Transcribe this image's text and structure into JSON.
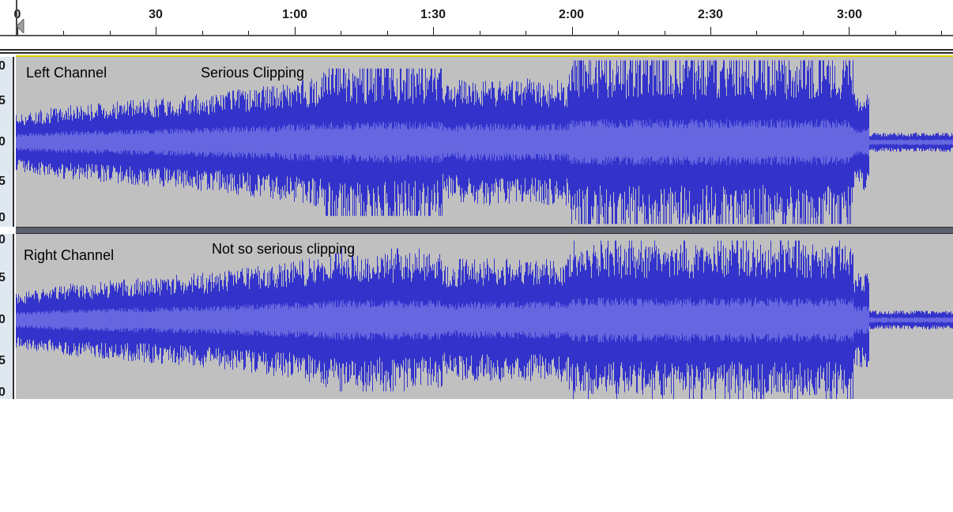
{
  "timeline": {
    "labels": [
      "0",
      "30",
      "1:00",
      "1:30",
      "2:00",
      "2:30",
      "3:00"
    ]
  },
  "vertical_scale": {
    "labels": [
      "0",
      "5",
      "0",
      "5",
      "0"
    ]
  },
  "tracks": {
    "left": {
      "name": "Left Channel",
      "annotation": "Serious Clipping"
    },
    "right": {
      "name": "Right Channel",
      "annotation": "Not so serious clipping"
    }
  },
  "colors": {
    "waveform": "#3333cc",
    "waveform_rms": "#6666e0",
    "track_background": "#c0c0c0",
    "ruler_background": "#dfe8f0",
    "selection_line": "#e0d000"
  }
}
